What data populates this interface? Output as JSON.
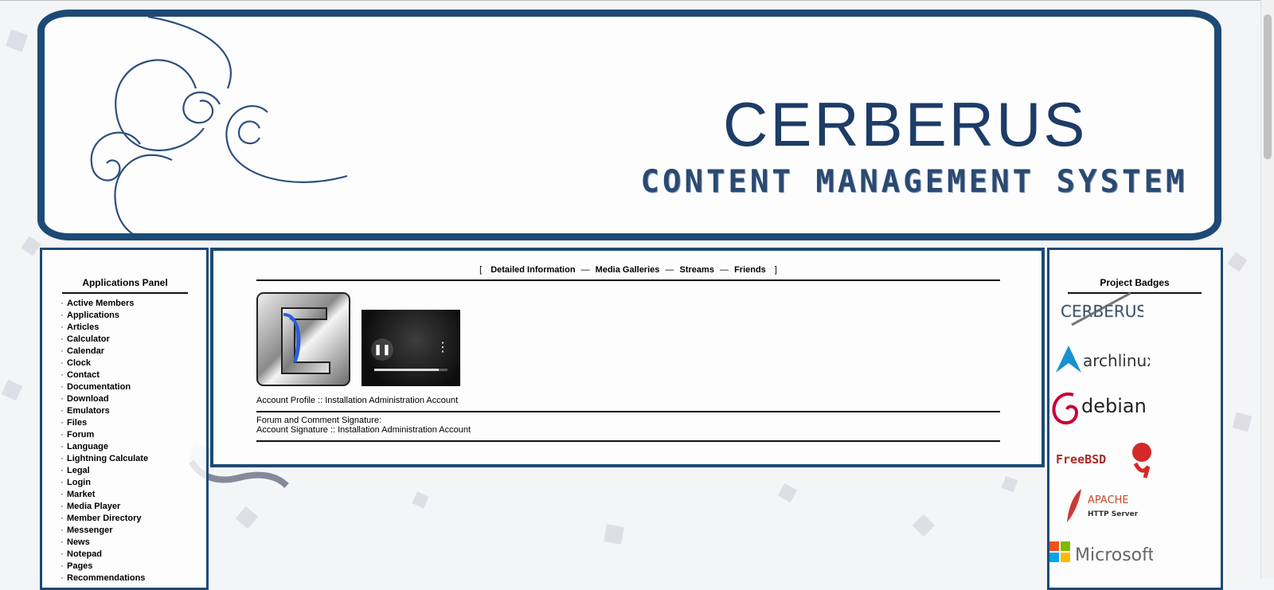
{
  "banner": {
    "title": "CERBERUS",
    "subtitle": "CONTENT MANAGEMENT SYSTEM"
  },
  "applications_panel": {
    "heading": "Applications Panel",
    "items": [
      "Active Members",
      "Applications",
      "Articles",
      "Calculator",
      "Calendar",
      "Clock",
      "Contact",
      "Documentation",
      "Download",
      "Emulators",
      "Files",
      "Forum",
      "Language",
      "Lightning Calculate",
      "Legal",
      "Login",
      "Market",
      "Media Player",
      "Member Directory",
      "Messenger",
      "News",
      "Notepad",
      "Pages",
      "Recommendations"
    ]
  },
  "main": {
    "nav": {
      "open_bracket": "[",
      "close_bracket": "]",
      "separator": "—",
      "links": [
        "Detailed Information",
        "Media Galleries",
        "Streams",
        "Friends"
      ]
    },
    "profile_line": "Account Profile :: Installation Administration Account",
    "signature_label": "Forum and Comment Signature:",
    "signature_text": "Account Signature :: Installation Administration Account",
    "video_progress": 0.88
  },
  "badges_panel": {
    "heading": "Project Badges",
    "badges": {
      "cerberus": "CERBERUS",
      "arch": "archlinux",
      "debian": "debian",
      "freebsd": "FreeBSD",
      "apache_top": "APACHE",
      "apache_bottom": "HTTP Server",
      "microsoft": "Microsoft"
    }
  },
  "colors": {
    "frame": "#1d4a74",
    "title": "#1d3c66"
  }
}
